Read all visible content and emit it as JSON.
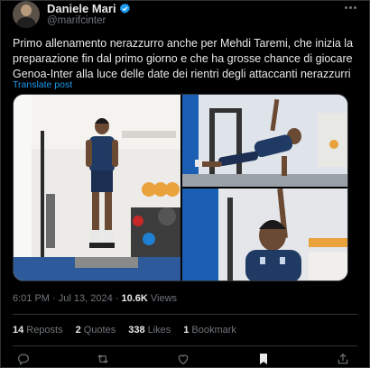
{
  "author": {
    "name": "Daniele Mari",
    "handle": "@marifcinter",
    "verified": true
  },
  "tweet": {
    "text": "Primo allenamento nerazzurro anche per Mehdi Taremi, che inizia la preparazione fin dal primo giorno e che ha grosse chance di giocare Genoa-Inter alla luce delle date dei rientri degli attaccanti nerazzurri",
    "translate_label": "Translate post"
  },
  "meta": {
    "time": "6:01 PM",
    "separator": " · ",
    "date": "Jul 13, 2024",
    "views_count": "10.6K",
    "views_label": " Views"
  },
  "stats": {
    "reposts_count": "14",
    "reposts_label": "Reposts",
    "quotes_count": "2",
    "quotes_label": "Quotes",
    "likes_count": "338",
    "likes_label": "Likes",
    "bookmarks_count": "1",
    "bookmarks_label": "Bookmark"
  },
  "icons": {
    "verified": "verified-badge-icon",
    "more": "more-dots-icon",
    "reply": "reply-icon",
    "repost": "repost-icon",
    "like": "heart-icon",
    "bookmark": "bookmark-icon",
    "share": "share-icon"
  },
  "colors": {
    "background": "#000000",
    "text": "#e7e9ea",
    "muted": "#71767b",
    "link": "#1d9bf0",
    "verified": "#1d9bf0",
    "border": "#2f3336"
  }
}
